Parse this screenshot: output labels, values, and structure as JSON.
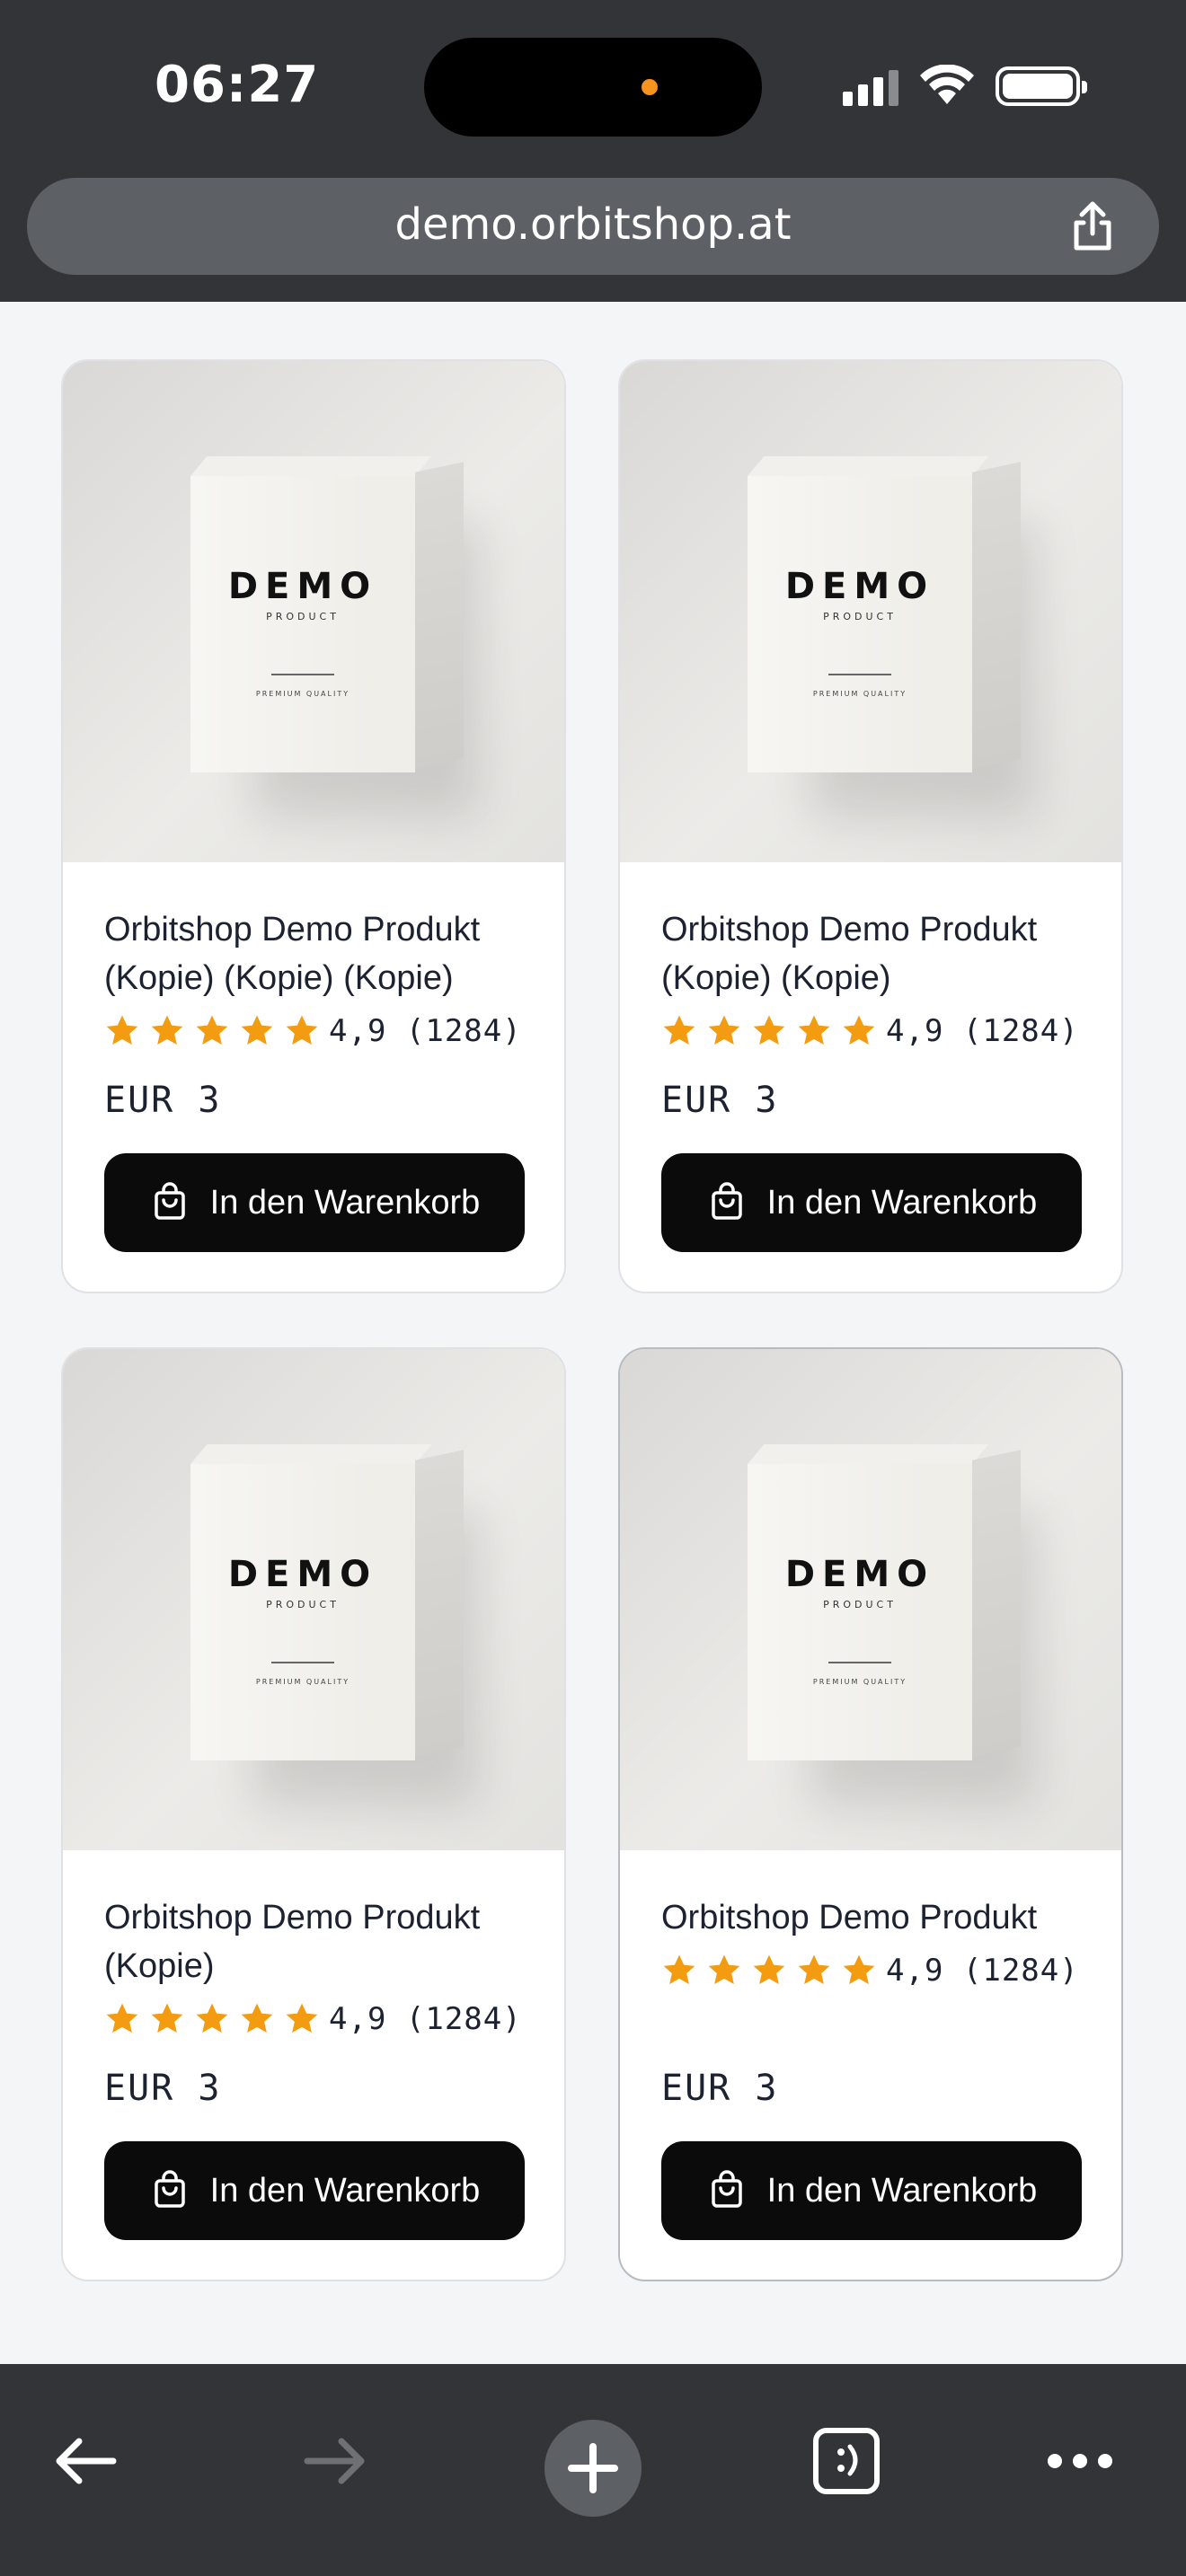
{
  "status_bar": {
    "time": "06:27"
  },
  "browser": {
    "url": "demo.orbitshop.at"
  },
  "products": [
    {
      "name": "Orbitshop Demo Produkt (Kopie) (Kopie) (Kopie)",
      "rating": "4,9 (1284)",
      "stars": 5,
      "price": "EUR 3",
      "button": "In den Warenkorb",
      "image": {
        "brand": "DEMO",
        "sub": "PRODUCT",
        "quality": "PREMIUM QUALITY"
      }
    },
    {
      "name": "Orbitshop Demo Produkt (Kopie) (Kopie)",
      "rating": "4,9 (1284)",
      "stars": 5,
      "price": "EUR 3",
      "button": "In den Warenkorb",
      "image": {
        "brand": "DEMO",
        "sub": "PRODUCT",
        "quality": "PREMIUM QUALITY"
      }
    },
    {
      "name": "Orbitshop Demo Produkt (Kopie)",
      "rating": "4,9 (1284)",
      "stars": 5,
      "price": "EUR 3",
      "button": "In den Warenkorb",
      "image": {
        "brand": "DEMO",
        "sub": "PRODUCT",
        "quality": "PREMIUM QUALITY"
      }
    },
    {
      "name": "Orbitshop Demo Produkt",
      "rating": "4,9 (1284)",
      "stars": 5,
      "price": "EUR 3",
      "button": "In den Warenkorb",
      "image": {
        "brand": "DEMO",
        "sub": "PRODUCT",
        "quality": "PREMIUM QUALITY"
      }
    }
  ],
  "colors": {
    "star": "#f39c12",
    "button": "#0b0b0b",
    "chrome": "#333437"
  },
  "toolbar": {
    "icons": [
      "back-arrow-icon",
      "forward-arrow-icon",
      "new-tab-plus-icon",
      "tabs-icon",
      "more-icon"
    ]
  }
}
